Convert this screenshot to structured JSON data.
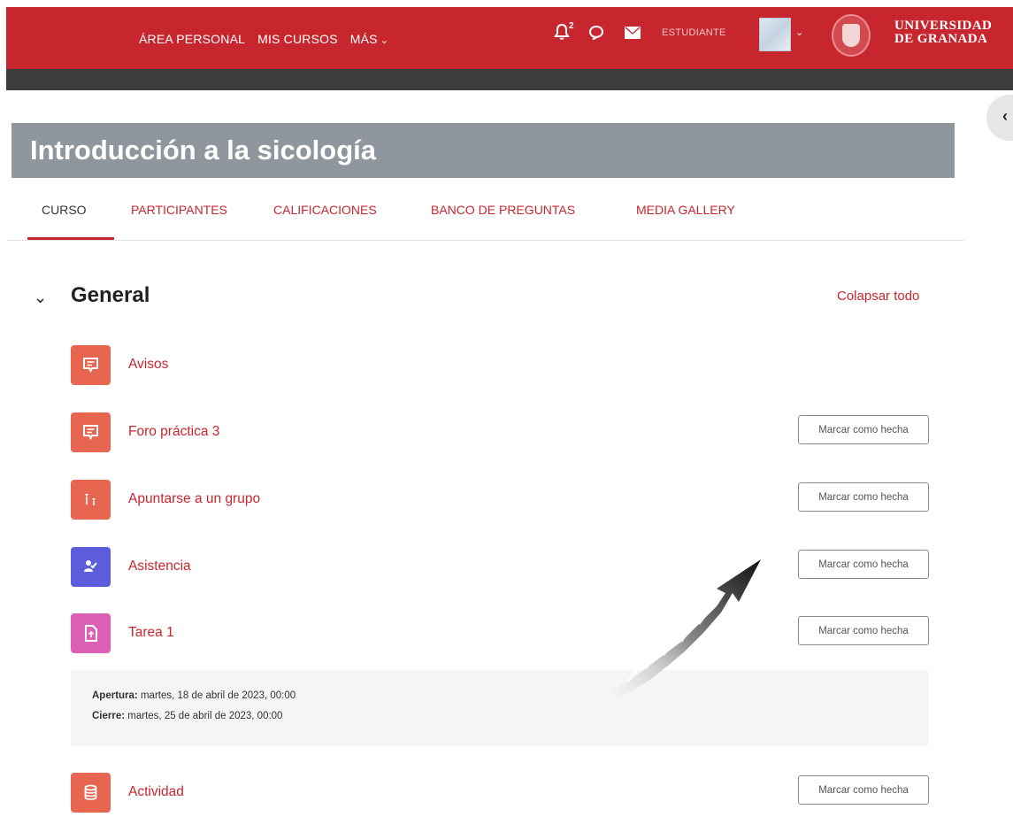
{
  "navbar": {
    "links": [
      "ÁREA PERSONAL",
      "MIS CURSOS",
      "MÁS"
    ],
    "notifications_count": "2",
    "user_name": "ESTUDIANTE",
    "university_line1": "UNIVERSIDAD",
    "university_line2": "DE GRANADA",
    "color": "#c7262e"
  },
  "course": {
    "title": "Introducción a la sicología"
  },
  "tabs": [
    {
      "label": "CURSO",
      "active": true
    },
    {
      "label": "PARTICIPANTES"
    },
    {
      "label": "CALIFICACIONES"
    },
    {
      "label": "BANCO DE PREGUNTAS"
    },
    {
      "label": "MEDIA GALLERY"
    }
  ],
  "section": {
    "title": "General",
    "collapse_all": "Colapsar todo"
  },
  "activities": [
    {
      "name": "Avisos",
      "icon": "forum-icon",
      "color": "#e8654f",
      "button": ""
    },
    {
      "name": "Foro práctica 3",
      "icon": "forum-icon",
      "color": "#e8654f",
      "button": "Marcar como hecha"
    },
    {
      "name": "Apuntarse a un grupo",
      "icon": "group-choice-icon",
      "color": "#e8654f",
      "button": "Marcar como hecha"
    },
    {
      "name": "Asistencia",
      "icon": "attendance-icon",
      "color": "#5b5ddc",
      "button": "Marcar como hecha"
    },
    {
      "name": "Tarea 1",
      "icon": "assignment-icon",
      "color": "#db5fb4",
      "button": "Marcar como hecha"
    },
    {
      "name": "Actividad",
      "icon": "database-icon",
      "color": "#e8654f",
      "button": "Marcar como hecha"
    }
  ],
  "assignment_dates": {
    "opening_label": "Apertura:",
    "opening_value": "martes, 18 de abril de 2023, 00:00",
    "closing_label": "Cierre:",
    "closing_value": "martes, 25 de abril de 2023, 00:00"
  }
}
